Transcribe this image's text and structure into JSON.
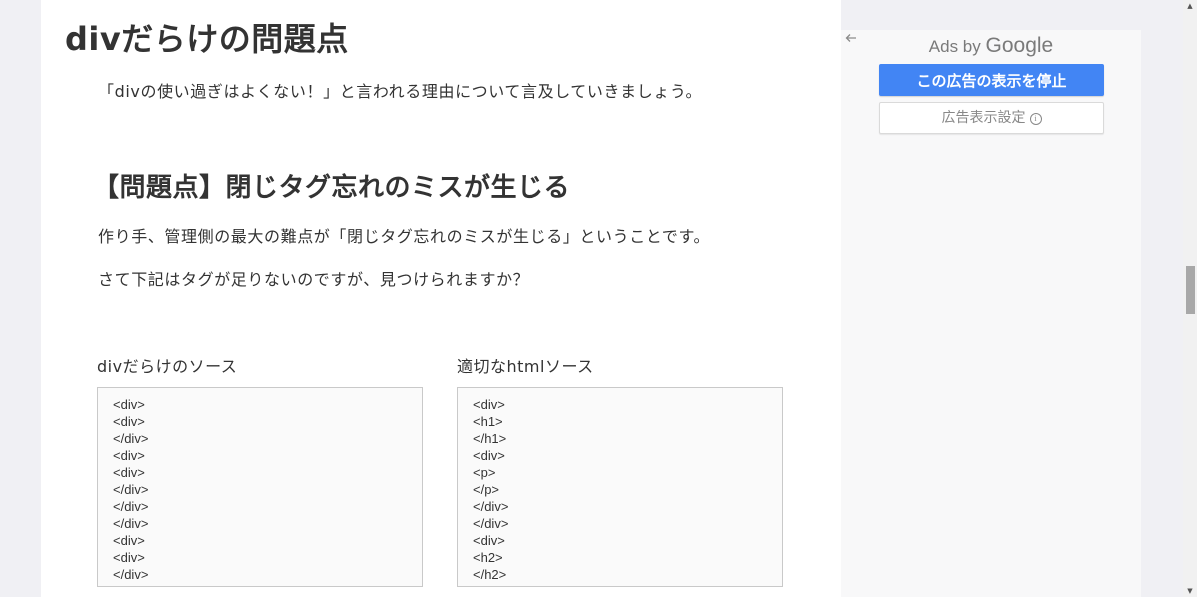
{
  "article": {
    "heading": "divだらけの問題点",
    "intro": "「divの使い過ぎはよくない！」と言われる理由について言及していきましょう。",
    "section_heading": "【問題点】閉じタグ忘れのミスが生じる",
    "para1": "作り手、管理側の最大の難点が「閉じタグ忘れのミスが生じる」ということです。",
    "para2": "さて下記はタグが足りないのですが、見つけられますか？",
    "left_label": "divだらけのソース",
    "right_label": "適切なhtmlソース",
    "left_code": [
      "<div>",
      "<div>",
      "</div>",
      "<div>",
      "<div>",
      "</div>",
      "</div>",
      "</div>",
      "<div>",
      "<div>",
      "</div>"
    ],
    "right_code": [
      "<div>",
      "<h1>",
      "</h1>",
      "<div>",
      "<p>",
      "</p>",
      "</div>",
      "</div>",
      "<div>",
      "<h2>",
      "</h2>"
    ]
  },
  "ad": {
    "ads_by": "Ads by",
    "google": "Google",
    "stop_button": "この広告の表示を停止",
    "settings_button": "広告表示設定",
    "accent_color": "#4285f4"
  }
}
